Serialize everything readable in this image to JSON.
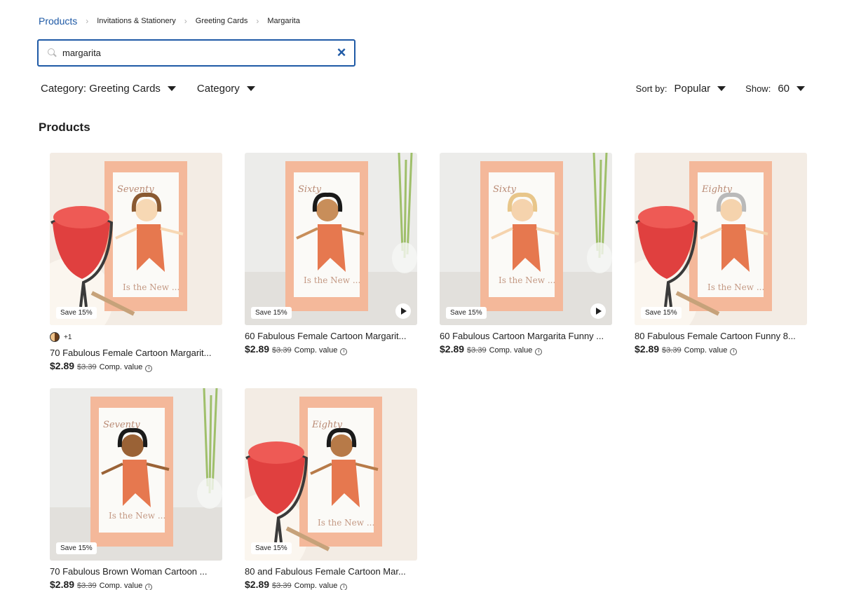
{
  "breadcrumb": [
    "Products",
    "Invitations & Stationery",
    "Greeting Cards",
    "Margarita"
  ],
  "search": {
    "value": "margarita",
    "clear_label": "×"
  },
  "filters": {
    "category_greeting": "Category: Greeting Cards",
    "category": "Category"
  },
  "sort": {
    "label": "Sort by:",
    "value": "Popular",
    "show_label": "Show:",
    "show_value": "60"
  },
  "section_title": "Products",
  "products": [
    {
      "badge": "Save 15%",
      "has_play": false,
      "swatch_count": "+1",
      "title": "70 Fabulous Female Cartoon Margarit...",
      "price": "$2.89",
      "old_price": "$3.39",
      "comp": "Comp. value",
      "card_word": "Seventy",
      "hair": "#8a5a32",
      "skin": "#f7d8b4",
      "margarita": true
    },
    {
      "badge": "Save 15%",
      "has_play": true,
      "title": "60 Fabulous Female Cartoon Margarit...",
      "price": "$2.89",
      "old_price": "$3.39",
      "comp": "Comp. value",
      "card_word": "Sixty",
      "hair": "#1a1a1a",
      "skin": "#c88e5a",
      "margarita": false
    },
    {
      "badge": "Save 15%",
      "has_play": true,
      "title": "60 Fabulous Cartoon Margarita Funny ...",
      "price": "$2.89",
      "old_price": "$3.39",
      "comp": "Comp. value",
      "card_word": "Sixty",
      "hair": "#e8c68a",
      "skin": "#f5d3ad",
      "margarita": false
    },
    {
      "badge": "Save 15%",
      "has_play": false,
      "title": "80 Fabulous Female Cartoon Funny 8...",
      "price": "$2.89",
      "old_price": "$3.39",
      "comp": "Comp. value",
      "card_word": "Eighty",
      "hair": "#b9b9b9",
      "skin": "#f5d3ad",
      "margarita": true
    },
    {
      "badge": "Save 15%",
      "has_play": false,
      "title": "70 Fabulous Brown Woman Cartoon ...",
      "price": "$2.89",
      "old_price": "$3.39",
      "comp": "Comp. value",
      "card_word": "Seventy",
      "hair": "#1a1a1a",
      "skin": "#9a6236",
      "margarita": false
    },
    {
      "badge": "Save 15%",
      "has_play": false,
      "title": "80 and Fabulous Female Cartoon Mar...",
      "price": "$2.89",
      "old_price": "$3.39",
      "comp": "Comp. value",
      "card_word": "Eighty",
      "hair": "#1a1a1a",
      "skin": "#b77a48",
      "margarita": true
    }
  ],
  "card_tagline": "Is the New ...",
  "colors": {
    "accent": "#1f5aa6",
    "card_peach": "#f4b89a",
    "glass_red": "#e0403f"
  }
}
